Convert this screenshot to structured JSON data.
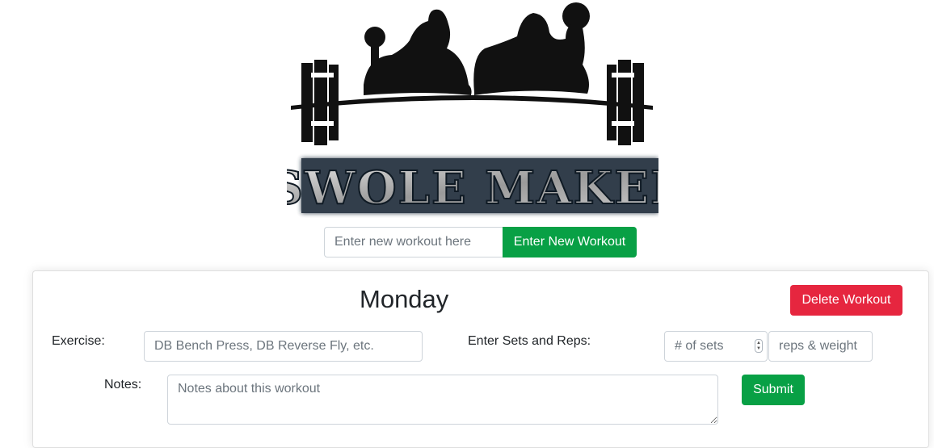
{
  "brand": {
    "logo_text": "SWOLE MAKER"
  },
  "new_workout": {
    "placeholder": "Enter new workout here",
    "button_label": "Enter New Workout"
  },
  "workout_card": {
    "day": "Monday",
    "delete_label": "Delete Workout",
    "exercise_label": "Exercise:",
    "exercise_placeholder": "DB Bench Press, DB Reverse Fly, etc.",
    "sets_reps_label": "Enter Sets and Reps:",
    "sets_placeholder": "# of sets",
    "reps_placeholder": "reps & weight",
    "notes_label": "Notes:",
    "notes_placeholder": "Notes about this workout",
    "submit_label": "Submit"
  },
  "colors": {
    "success": "#08a045",
    "danger": "#e6263f"
  },
  "icons": {
    "logo": "weightlifters-barbell-logo",
    "stepper": "number-stepper-icon"
  }
}
